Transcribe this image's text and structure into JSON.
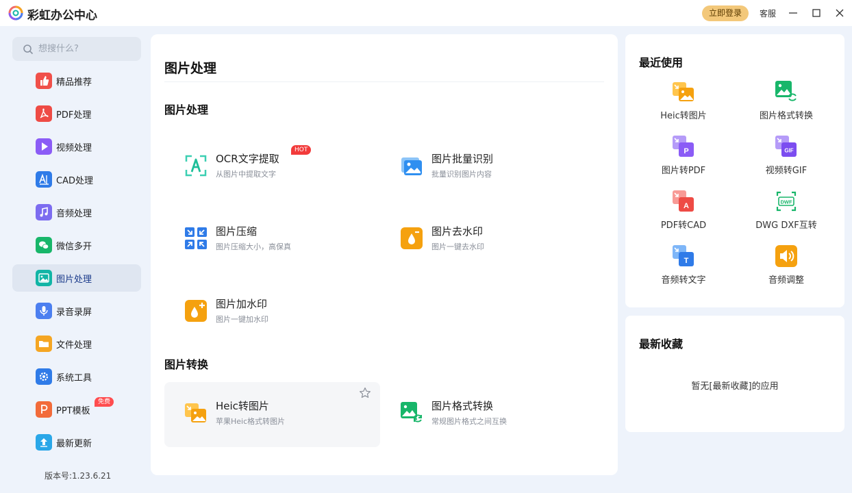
{
  "app": {
    "title": "彩虹办公中心"
  },
  "titlebar": {
    "login_label": "立即登录",
    "service_label": "客服"
  },
  "search": {
    "placeholder": "想搜什么?"
  },
  "sidebar": {
    "items": [
      {
        "label": "精品推荐",
        "icon": "thumbs-up-icon",
        "color": "#f0504a"
      },
      {
        "label": "PDF处理",
        "icon": "pdf-icon",
        "color": "#ee4b45"
      },
      {
        "label": "视频处理",
        "icon": "play-icon",
        "color": "#8b5cf6"
      },
      {
        "label": "CAD处理",
        "icon": "cad-icon",
        "color": "#2f7be8"
      },
      {
        "label": "音频处理",
        "icon": "music-icon",
        "color": "#7c6cf0"
      },
      {
        "label": "微信多开",
        "icon": "wechat-icon",
        "color": "#18b66a"
      },
      {
        "label": "图片处理",
        "icon": "image-icon",
        "color": "#12b5a6"
      },
      {
        "label": "录音录屏",
        "icon": "microphone-icon",
        "color": "#4c7ff0"
      },
      {
        "label": "文件处理",
        "icon": "folder-icon",
        "color": "#f5a623"
      },
      {
        "label": "系统工具",
        "icon": "gear-icon",
        "color": "#2f7be8"
      },
      {
        "label": "PPT模板",
        "icon": "ppt-icon",
        "color": "#f26b3a",
        "badge": "免费"
      },
      {
        "label": "最新更新",
        "icon": "upload-icon",
        "color": "#2aa7e8"
      }
    ],
    "active_index": 6,
    "version": "版本号:1.23.6.21"
  },
  "main": {
    "title": "图片处理",
    "section1": {
      "title": "图片处理",
      "tools": [
        {
          "name": "OCR文字提取",
          "desc": "从图片中提取文字",
          "badge": "HOT",
          "icon": "ocr-icon"
        },
        {
          "name": "图片批量识别",
          "desc": "批量识别图片内容",
          "icon": "image-batch-icon"
        },
        {
          "name": "图片压缩",
          "desc": "图片压缩大小，高保真",
          "icon": "compress-icon"
        },
        {
          "name": "图片去水印",
          "desc": "图片一键去水印",
          "icon": "remove-watermark-icon"
        },
        {
          "name": "图片加水印",
          "desc": "图片一键加水印",
          "icon": "add-watermark-icon"
        }
      ]
    },
    "section2": {
      "title": "图片转换",
      "tools": [
        {
          "name": "Heic转图片",
          "desc": "苹果Heic格式转图片",
          "icon": "heic-icon"
        },
        {
          "name": "图片格式转换",
          "desc": "常规图片格式之间互换",
          "icon": "image-convert-icon"
        }
      ]
    }
  },
  "recent": {
    "title": "最近使用",
    "items": [
      {
        "label": "Heic转图片",
        "icon": "heic-icon"
      },
      {
        "label": "图片格式转换",
        "icon": "image-convert-icon"
      },
      {
        "label": "图片转PDF",
        "icon": "image-to-pdf-icon"
      },
      {
        "label": "视频转GIF",
        "icon": "video-to-gif-icon"
      },
      {
        "label": "PDF转CAD",
        "icon": "pdf-to-cad-icon"
      },
      {
        "label": "DWG DXF互转",
        "icon": "dwg-dxf-icon"
      },
      {
        "label": "音频转文字",
        "icon": "audio-to-text-icon"
      },
      {
        "label": "音频调整",
        "icon": "audio-adjust-icon"
      }
    ]
  },
  "favorites": {
    "title": "最新收藏",
    "empty_text": "暂无[最新收藏]的应用"
  },
  "colors": {
    "accent": "#2f7be8",
    "login_bg": "#f3c87a",
    "hot": "#f23b3b",
    "sidebar_active": "#dfe6f1"
  }
}
